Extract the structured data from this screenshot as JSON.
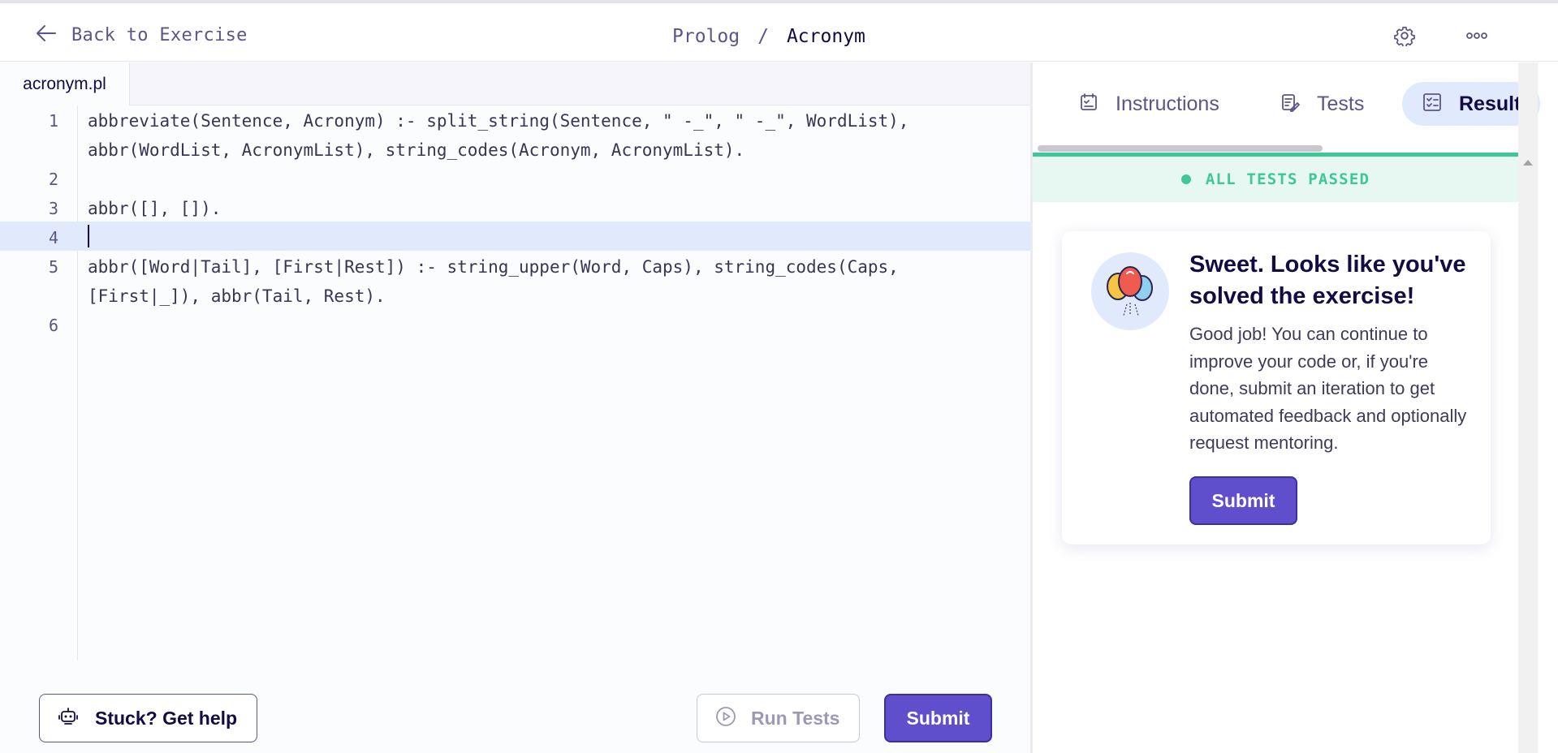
{
  "header": {
    "back_label": "Back to Exercise",
    "track": "Prolog",
    "separator": "/",
    "exercise": "Acronym"
  },
  "editor": {
    "file_tab": "acronym.pl",
    "lines": [
      {
        "num": "1",
        "text": "abbreviate(Sentence, Acronym) :- split_string(Sentence, \" -_\", \" -_\", WordList),"
      },
      {
        "num": "",
        "text": "abbr(WordList, AcronymList), string_codes(Acronym, AcronymList)."
      },
      {
        "num": "2",
        "text": ""
      },
      {
        "num": "3",
        "text": "abbr([], [])."
      },
      {
        "num": "4",
        "text": ""
      },
      {
        "num": "5",
        "text": "abbr([Word|Tail], [First|Rest]) :- string_upper(Word, Caps), string_codes(Caps,"
      },
      {
        "num": "",
        "text": "[First|_]), abbr(Tail, Rest)."
      },
      {
        "num": "6",
        "text": ""
      }
    ],
    "active_line": "4"
  },
  "actions": {
    "help_label": "Stuck? Get help",
    "run_label": "Run Tests",
    "submit_label": "Submit"
  },
  "panel": {
    "tabs": [
      {
        "label": "Instructions",
        "icon": "instructions-icon"
      },
      {
        "label": "Tests",
        "icon": "tests-icon"
      },
      {
        "label": "Results",
        "icon": "results-icon",
        "active": true
      }
    ],
    "status": "ALL TESTS PASSED",
    "card": {
      "title": "Sweet. Looks like you've solved the exercise!",
      "body": "Good job! You can continue to improve your code or, if you're done, submit an iteration to get automated feedback and optionally request mentoring.",
      "submit_label": "Submit",
      "icon": "balloons-icon"
    }
  },
  "colors": {
    "accent": "#604fcd",
    "success": "#3fc79a",
    "active_line": "#e1eafc"
  }
}
